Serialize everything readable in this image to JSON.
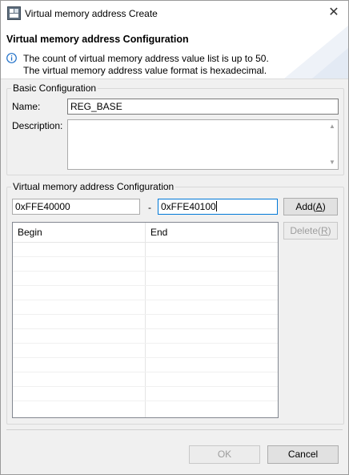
{
  "window": {
    "title": "Virtual memory address Create",
    "close_glyph": "✕"
  },
  "header": {
    "title": "Virtual memory address Configuration",
    "info_line1": "The count of virtual memory address value list is up to 50.",
    "info_line2": "The virtual memory address value format is hexadecimal."
  },
  "basic": {
    "group_label": "Basic Configuration",
    "name_label": "Name:",
    "name_value": "REG_BASE",
    "description_label": "Description:",
    "description_value": ""
  },
  "vma": {
    "group_label": "Virtual memory address Configuration",
    "begin_value": "0xFFE40000",
    "dash": "-",
    "end_value": "0xFFE40100",
    "add_label": "Add(",
    "add_mnemonic": "A",
    "delete_label": "Delete(",
    "delete_mnemonic": "R",
    "close_paren": ")",
    "columns": [
      "Begin",
      "End"
    ]
  },
  "footer": {
    "ok_label": "OK",
    "cancel_label": "Cancel"
  },
  "colors": {
    "accent": "#0078d7",
    "info": "#1e6fc8"
  }
}
